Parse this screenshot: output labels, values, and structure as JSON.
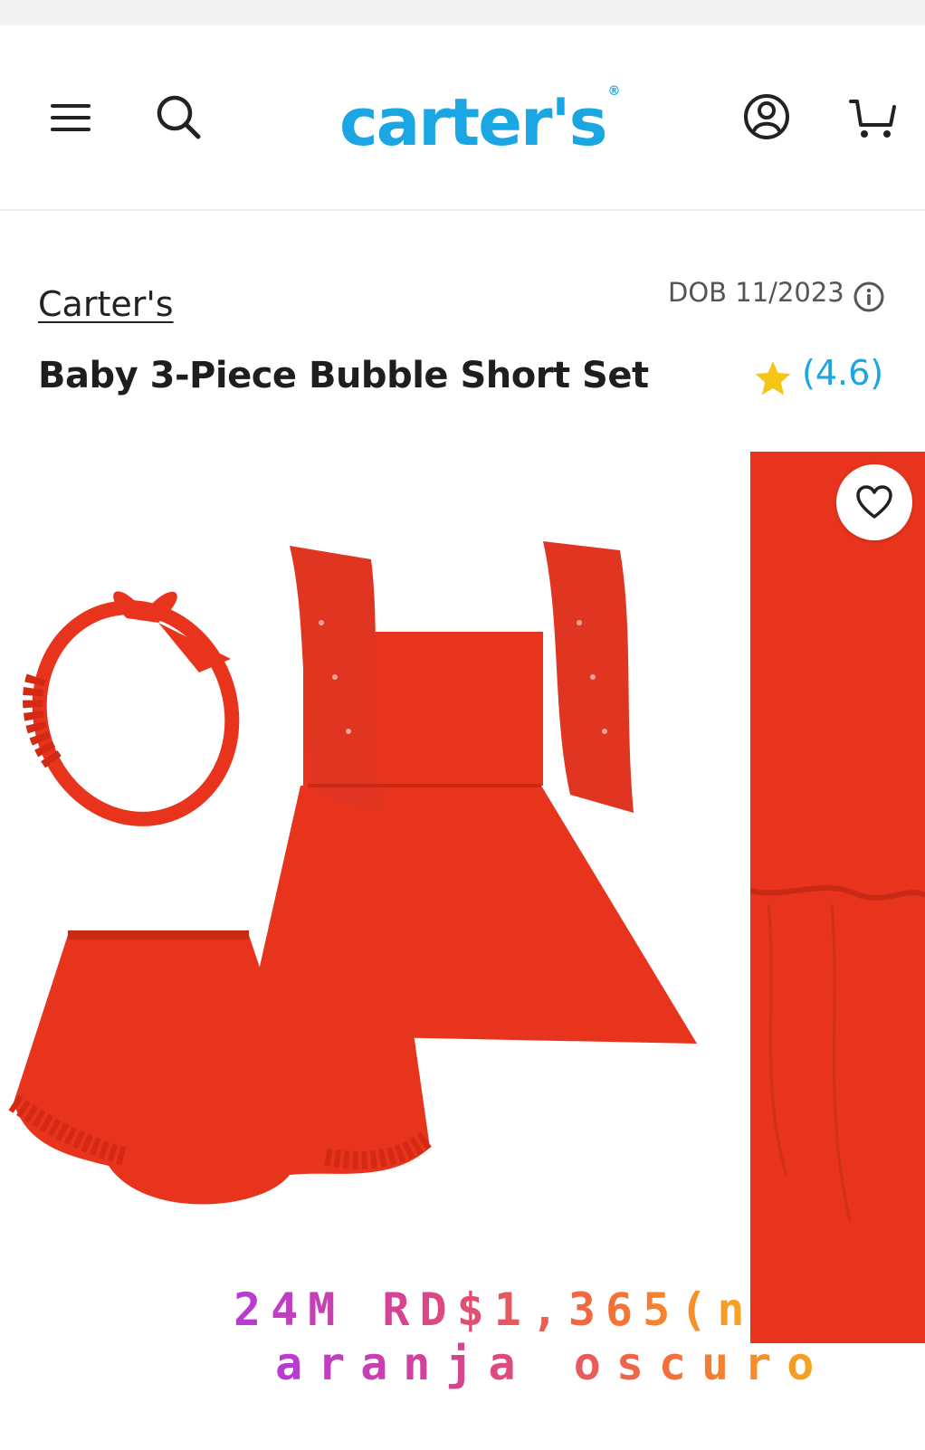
{
  "header": {
    "logo_text": "carter's",
    "logo_mark": "®",
    "icons": {
      "menu": "hamburger-menu-icon",
      "search": "search-icon",
      "account": "account-icon",
      "cart": "cart-icon"
    },
    "brand_color": "#1aa6e3"
  },
  "product": {
    "brand_link": "Carter's",
    "dob": "DOB 11/2023",
    "title": "Baby 3-Piece Bubble Short Set",
    "rating": "(4.6)",
    "rating_star_color": "#f5c518",
    "garment_color": "#e8341c"
  },
  "overlay": {
    "line1": "24M RD$1,365(n",
    "line2": "aranja oscuro"
  }
}
